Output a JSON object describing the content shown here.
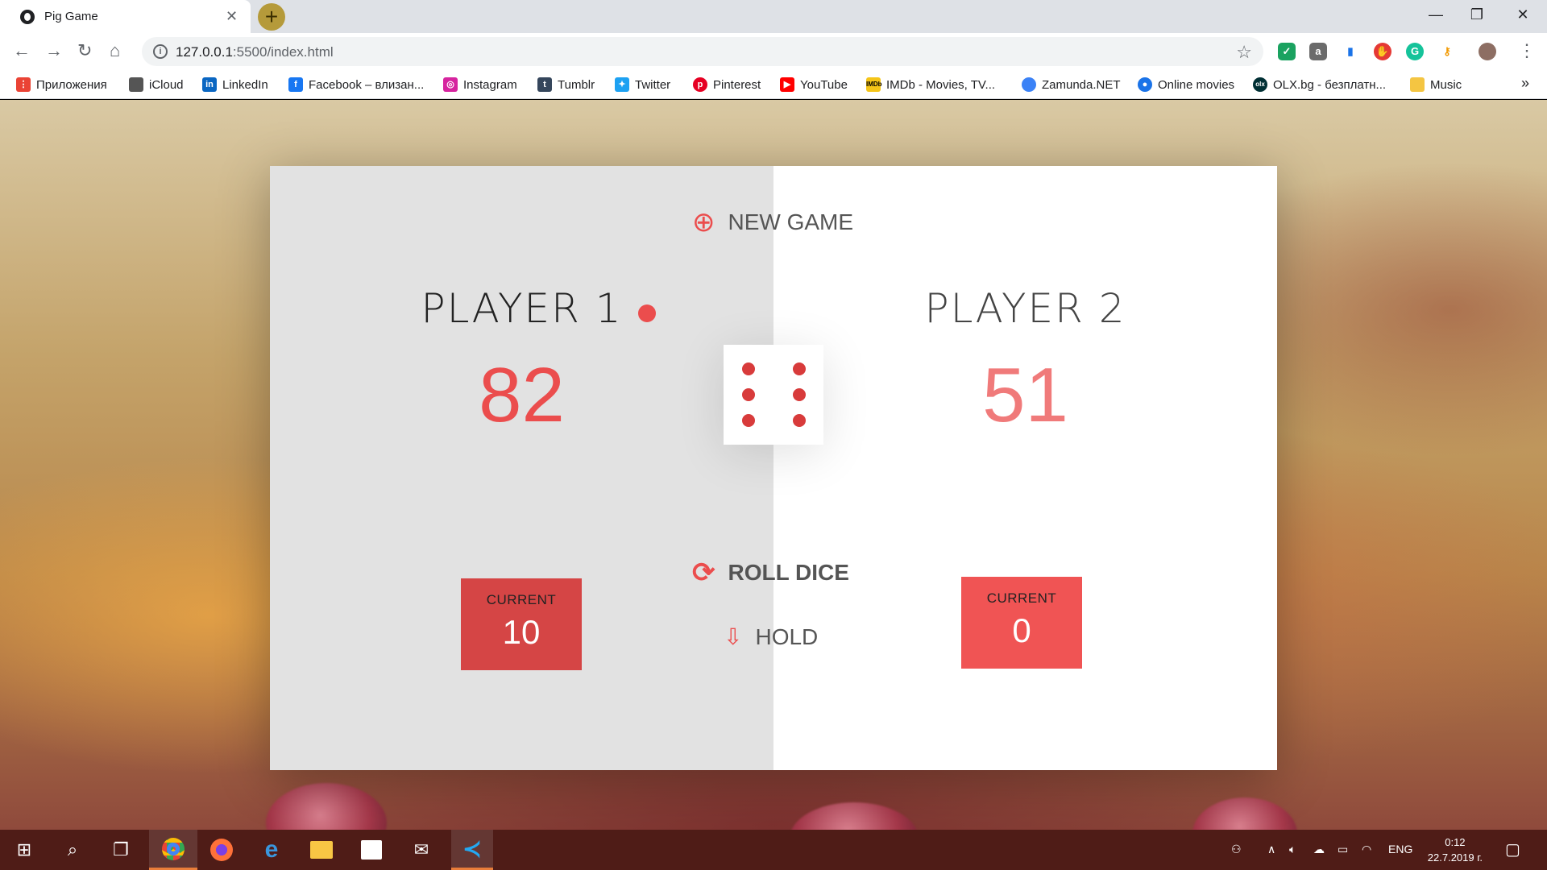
{
  "browser": {
    "tab_title": "Pig Game",
    "tab_close": "✕",
    "new_tab": "+",
    "window_controls": {
      "minimize": "—",
      "maximize": "❐",
      "close": "✕"
    },
    "url_host": "127.0.0.1",
    "url_path": ":5500/index.html",
    "bookmarks": [
      {
        "label": "Приложения",
        "icon": "apps-grid-icon",
        "color": "#ea4335"
      },
      {
        "label": "iCloud",
        "icon": "apple-icon",
        "color": "#555555"
      },
      {
        "label": "LinkedIn",
        "icon": "linkedin-icon",
        "color": "#0a66c2"
      },
      {
        "label": "Facebook – влизан...",
        "icon": "facebook-icon",
        "color": "#1877f2"
      },
      {
        "label": "Instagram",
        "icon": "instagram-icon",
        "color": "#d6249f"
      },
      {
        "label": "Tumblr",
        "icon": "tumblr-icon",
        "color": "#35465c"
      },
      {
        "label": "Twitter",
        "icon": "twitter-icon",
        "color": "#1da1f2"
      },
      {
        "label": "Pinterest",
        "icon": "pinterest-icon",
        "color": "#e60023"
      },
      {
        "label": "YouTube",
        "icon": "youtube-icon",
        "color": "#ff0000"
      },
      {
        "label": "IMDb - Movies, TV...",
        "icon": "imdb-icon",
        "color": "#f5c518"
      },
      {
        "label": "Zamunda.NET",
        "icon": "zamunda-icon",
        "color": "#3b82f6"
      },
      {
        "label": "Online movies",
        "icon": "location-pin-icon",
        "color": "#1a73e8"
      },
      {
        "label": "OLX.bg - безплатн...",
        "icon": "olx-icon",
        "color": "#002f34"
      },
      {
        "label": "Music",
        "icon": "folder-icon",
        "color": "#f4c542"
      }
    ],
    "more": "»"
  },
  "game": {
    "new_game": "NEW GAME",
    "roll_dice": "ROLL DICE",
    "hold": "HOLD",
    "dice_value": 6,
    "active_player": 1,
    "players": [
      {
        "name": "PLAYER 1",
        "score": "82",
        "current_label": "CURRENT",
        "current": "10"
      },
      {
        "name": "PLAYER 2",
        "score": "51",
        "current_label": "CURRENT",
        "current": "0"
      }
    ],
    "accent_color": "#eb4d4d"
  },
  "taskbar": {
    "language": "ENG",
    "time": "0:12",
    "date": "22.7.2019 г."
  }
}
